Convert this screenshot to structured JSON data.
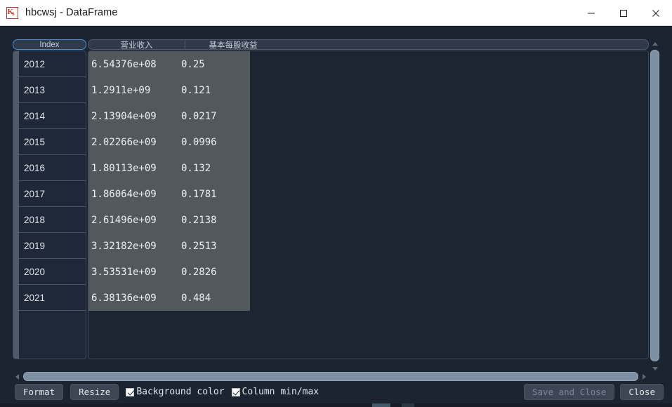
{
  "window": {
    "title": "hbcwsj - DataFrame",
    "icon": "spyder-dataframe-icon",
    "minimize_label": "—",
    "maximize_label": "□",
    "close_label": "✕"
  },
  "table": {
    "index_header": "Index",
    "columns": [
      "营业收入",
      "基本每股收益"
    ],
    "index": [
      "2012",
      "2013",
      "2014",
      "2015",
      "2016",
      "2017",
      "2018",
      "2019",
      "2020",
      "2021"
    ],
    "rows": [
      {
        "index": "2012",
        "values": [
          "6.54376e+08",
          "0.25"
        ]
      },
      {
        "index": "2013",
        "values": [
          "1.2911e+09",
          "0.121"
        ]
      },
      {
        "index": "2014",
        "values": [
          "2.13904e+09",
          "0.0217"
        ]
      },
      {
        "index": "2015",
        "values": [
          "2.02266e+09",
          "0.0996"
        ]
      },
      {
        "index": "2016",
        "values": [
          "1.80113e+09",
          "0.132"
        ]
      },
      {
        "index": "2017",
        "values": [
          "1.86064e+09",
          "0.1781"
        ]
      },
      {
        "index": "2018",
        "values": [
          "2.61496e+09",
          "0.2138"
        ]
      },
      {
        "index": "2019",
        "values": [
          "3.32182e+09",
          "0.2513"
        ]
      },
      {
        "index": "2020",
        "values": [
          "3.53531e+09",
          "0.2826"
        ]
      },
      {
        "index": "2021",
        "values": [
          "6.38136e+09",
          "0.484"
        ]
      }
    ]
  },
  "toolbar": {
    "format_label": "Format",
    "resize_label": "Resize",
    "background_color_label": "Background color",
    "background_color_checked": true,
    "column_minmax_label": "Column min/max",
    "column_minmax_checked": true,
    "save_and_close_label": "Save and Close",
    "save_and_close_enabled": false,
    "close_label": "Close"
  },
  "scrollbars": {
    "vertical_up": "scroll-up-arrow",
    "vertical_down": "scroll-down-arrow",
    "horizontal_left": "scroll-left-arrow",
    "horizontal_right": "scroll-right-arrow"
  },
  "colors": {
    "accent": "#4a90d9",
    "titlebar_bg": "#ffffff",
    "client_bg": "#1b2430",
    "cell_bg": "#53585e",
    "index_bg": "#1e2838",
    "scroll_thumb": "#7d8fa3"
  }
}
